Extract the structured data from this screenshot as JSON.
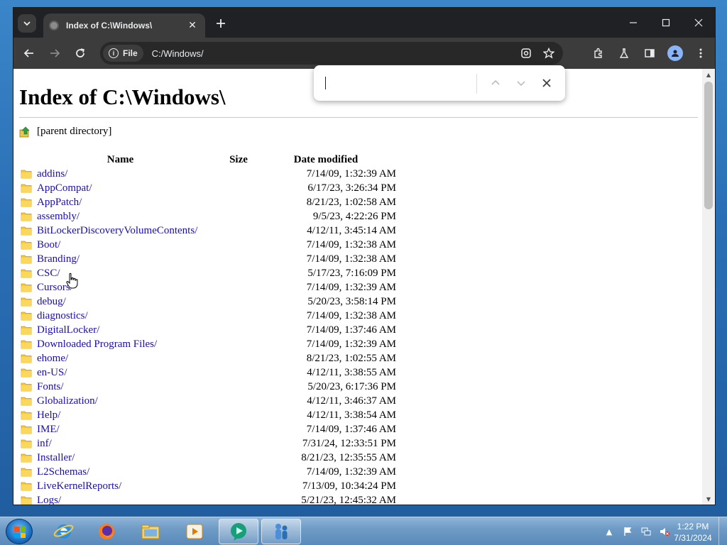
{
  "browser": {
    "tab_title": "Index of C:\\Windows\\",
    "address_chip": "File",
    "url": "C:/Windows/"
  },
  "page": {
    "heading": "Index of C:\\Windows\\",
    "parent_directory": "[parent directory]",
    "columns": {
      "name": "Name",
      "size": "Size",
      "date": "Date modified"
    },
    "entries": [
      {
        "name": "addins/",
        "size": "",
        "date": "7/14/09, 1:32:39 AM"
      },
      {
        "name": "AppCompat/",
        "size": "",
        "date": "6/17/23, 3:26:34 PM"
      },
      {
        "name": "AppPatch/",
        "size": "",
        "date": "8/21/23, 1:02:58 AM"
      },
      {
        "name": "assembly/",
        "size": "",
        "date": "9/5/23, 4:22:26 PM"
      },
      {
        "name": "BitLockerDiscoveryVolumeContents/",
        "size": "",
        "date": "4/12/11, 3:45:14 AM"
      },
      {
        "name": "Boot/",
        "size": "",
        "date": "7/14/09, 1:32:38 AM"
      },
      {
        "name": "Branding/",
        "size": "",
        "date": "7/14/09, 1:32:38 AM"
      },
      {
        "name": "CSC/",
        "size": "",
        "date": "5/17/23, 7:16:09 PM"
      },
      {
        "name": "Cursors/",
        "size": "",
        "date": "7/14/09, 1:32:39 AM"
      },
      {
        "name": "debug/",
        "size": "",
        "date": "5/20/23, 3:58:14 PM"
      },
      {
        "name": "diagnostics/",
        "size": "",
        "date": "7/14/09, 1:32:38 AM"
      },
      {
        "name": "DigitalLocker/",
        "size": "",
        "date": "7/14/09, 1:37:46 AM"
      },
      {
        "name": "Downloaded Program Files/",
        "size": "",
        "date": "7/14/09, 1:32:39 AM"
      },
      {
        "name": "ehome/",
        "size": "",
        "date": "8/21/23, 1:02:55 AM"
      },
      {
        "name": "en-US/",
        "size": "",
        "date": "4/12/11, 3:38:55 AM"
      },
      {
        "name": "Fonts/",
        "size": "",
        "date": "5/20/23, 6:17:36 PM"
      },
      {
        "name": "Globalization/",
        "size": "",
        "date": "4/12/11, 3:46:37 AM"
      },
      {
        "name": "Help/",
        "size": "",
        "date": "4/12/11, 3:38:54 AM"
      },
      {
        "name": "IME/",
        "size": "",
        "date": "7/14/09, 1:37:46 AM"
      },
      {
        "name": "inf/",
        "size": "",
        "date": "7/31/24, 12:33:51 PM"
      },
      {
        "name": "Installer/",
        "size": "",
        "date": "8/21/23, 12:35:55 AM"
      },
      {
        "name": "L2Schemas/",
        "size": "",
        "date": "7/14/09, 1:32:39 AM"
      },
      {
        "name": "LiveKernelReports/",
        "size": "",
        "date": "7/13/09, 10:34:24 PM"
      },
      {
        "name": "Logs/",
        "size": "",
        "date": "5/21/23, 12:45:32 AM"
      }
    ]
  },
  "find_bar": {
    "value": ""
  },
  "taskbar": {
    "clock_time": "1:22 PM",
    "clock_date": "7/31/2024"
  },
  "colors": {
    "link": "#1a0dab",
    "folder": "#f5c842",
    "chrome_dark": "#202124",
    "toolbar": "#3c3c3c"
  },
  "icons": {
    "titlebar": [
      "tab-list-icon",
      "globe-icon",
      "close-icon",
      "plus-icon",
      "minimize-icon",
      "maximize-icon",
      "close-window-icon"
    ],
    "toolbar": [
      "back-icon",
      "forward-icon",
      "reload-icon",
      "info-icon",
      "lens-icon",
      "bookmark-star-icon",
      "extensions-icon",
      "labs-icon",
      "side-panel-icon",
      "profile-icon",
      "menu-icon"
    ],
    "find": [
      "chevron-up-icon",
      "chevron-down-icon",
      "close-icon"
    ]
  }
}
